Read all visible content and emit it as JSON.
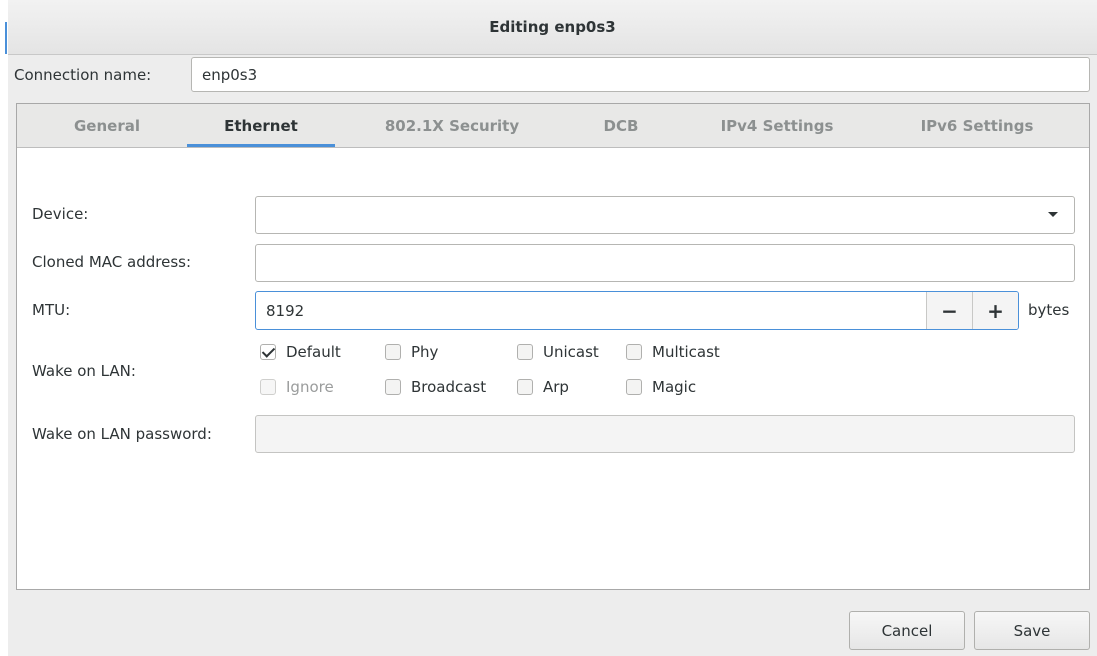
{
  "window": {
    "title": "Editing enp0s3"
  },
  "connection": {
    "label": "Connection name:",
    "value": "enp0s3"
  },
  "tabs": [
    {
      "label": "General",
      "active": false
    },
    {
      "label": "Ethernet",
      "active": true
    },
    {
      "label": "802.1X Security",
      "active": false
    },
    {
      "label": "DCB",
      "active": false
    },
    {
      "label": "IPv4 Settings",
      "active": false
    },
    {
      "label": "IPv6 Settings",
      "active": false
    }
  ],
  "ethernet": {
    "device": {
      "label": "Device:",
      "value": "",
      "dropdown_icon": "chevron-down-icon"
    },
    "cloned_mac": {
      "label": "Cloned MAC address:",
      "value": ""
    },
    "mtu": {
      "label": "MTU:",
      "value": "8192",
      "minus": "−",
      "plus": "+",
      "unit": "bytes"
    },
    "wake_on_lan": {
      "label": "Wake on LAN:",
      "options": [
        {
          "label": "Default",
          "checked": true,
          "disabled": false
        },
        {
          "label": "Phy",
          "checked": false,
          "disabled": false
        },
        {
          "label": "Unicast",
          "checked": false,
          "disabled": false
        },
        {
          "label": "Multicast",
          "checked": false,
          "disabled": false
        },
        {
          "label": "Ignore",
          "checked": false,
          "disabled": true
        },
        {
          "label": "Broadcast",
          "checked": false,
          "disabled": false
        },
        {
          "label": "Arp",
          "checked": false,
          "disabled": false
        },
        {
          "label": "Magic",
          "checked": false,
          "disabled": false
        }
      ]
    },
    "wol_password": {
      "label": "Wake on LAN password:",
      "value": ""
    }
  },
  "buttons": {
    "cancel": "Cancel",
    "save": "Save"
  },
  "colors": {
    "accent": "#4a90d9",
    "background": "#ededed",
    "text": "#2e3436"
  }
}
